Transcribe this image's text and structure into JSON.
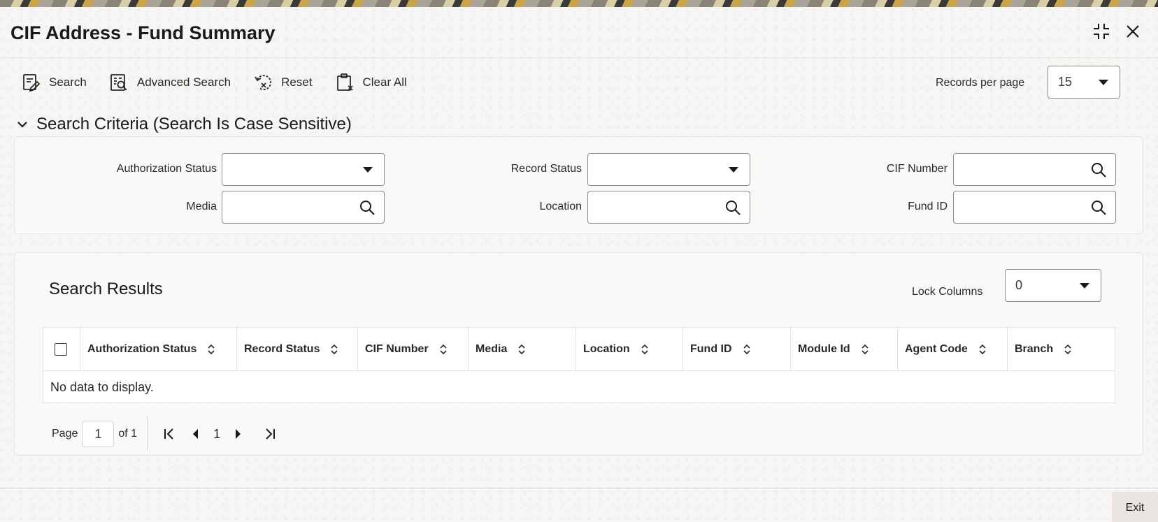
{
  "window": {
    "title": "CIF Address - Fund Summary"
  },
  "toolbar": {
    "search_label": "Search",
    "advanced_search_label": "Advanced Search",
    "reset_label": "Reset",
    "clear_all_label": "Clear All",
    "records_per_page_label": "Records per page",
    "records_per_page_value": "15"
  },
  "criteria": {
    "heading": "Search Criteria (Search Is Case Sensitive)",
    "fields": {
      "authorization_status": {
        "label": "Authorization Status",
        "value": ""
      },
      "record_status": {
        "label": "Record Status",
        "value": ""
      },
      "cif_number": {
        "label": "CIF Number",
        "value": ""
      },
      "media": {
        "label": "Media",
        "value": ""
      },
      "location": {
        "label": "Location",
        "value": ""
      },
      "fund_id": {
        "label": "Fund ID",
        "value": ""
      }
    }
  },
  "results": {
    "title": "Search Results",
    "lock_columns_label": "Lock Columns",
    "lock_columns_value": "0",
    "columns": [
      "Authorization Status",
      "Record Status",
      "CIF Number",
      "Media",
      "Location",
      "Fund ID",
      "Module Id",
      "Agent Code",
      "Branch"
    ],
    "rows": [],
    "empty_message": "No data to display."
  },
  "pagination": {
    "page_label": "Page",
    "current_page": "1",
    "of_label": "of 1",
    "page_number": "1"
  },
  "footer": {
    "exit_label": "Exit"
  }
}
